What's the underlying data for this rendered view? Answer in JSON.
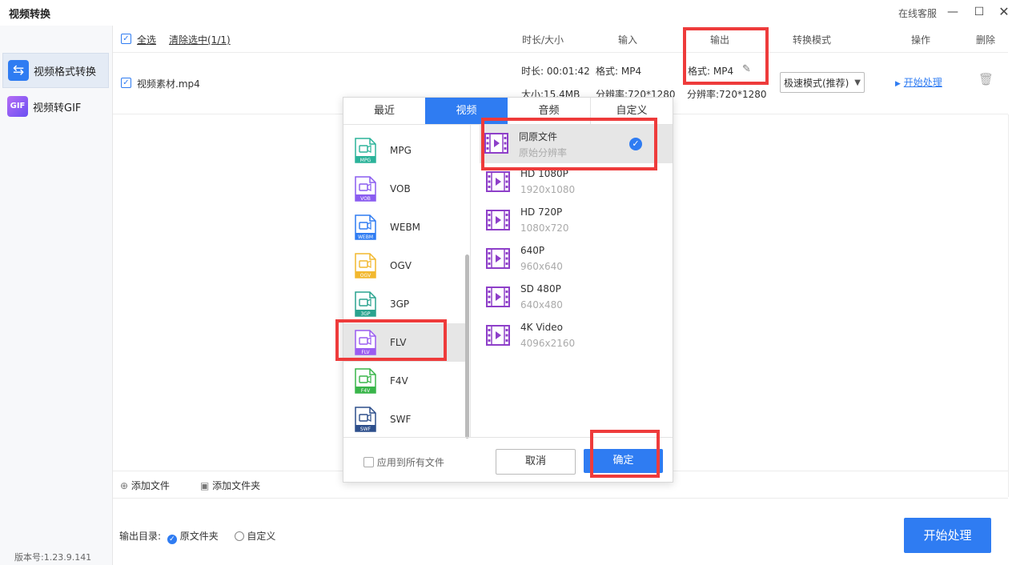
{
  "window": {
    "title": "视频转换",
    "support": "在线客服"
  },
  "sidebar": {
    "items": [
      {
        "label": "视频格式转换",
        "icon": "swap-arrows-icon",
        "active": true
      },
      {
        "label": "视频转GIF",
        "icon_text": "GIF"
      }
    ],
    "version": "版本号:1.23.9.141"
  },
  "table": {
    "select_all": "全选",
    "clear_selected": "清除选中(1/1)",
    "headers": {
      "duration_size": "时长/大小",
      "input": "输入",
      "output": "输出",
      "mode": "转换模式",
      "action": "操作",
      "delete": "删除"
    }
  },
  "file": {
    "name": "视频素材.mp4",
    "duration": "时长: 00:01:42",
    "size": "大小:15.4MB",
    "input_format": "格式: MP4",
    "input_resolution": "分辨率:720*1280",
    "output_format": "格式: MP4",
    "output_resolution": "分辨率:720*1280",
    "mode": "极速模式(推荐)",
    "start": "开始处理"
  },
  "toolbar": {
    "add_file": "添加文件",
    "add_folder": "添加文件夹"
  },
  "footer": {
    "output_dir_label": "输出目录:",
    "original_folder": "原文件夹",
    "custom": "自定义",
    "start_button": "开始处理"
  },
  "popup": {
    "tabs": [
      "最近",
      "视频",
      "音频",
      "自定义"
    ],
    "active_tab": "视频",
    "formats": [
      {
        "name": "MPG",
        "color": "#2bb39a"
      },
      {
        "name": "VOB",
        "color": "#8a5cf0"
      },
      {
        "name": "WEBM",
        "color": "#2f7cf2"
      },
      {
        "name": "OGV",
        "color": "#f2b82f"
      },
      {
        "name": "3GP",
        "color": "#2aa38f"
      },
      {
        "name": "FLV",
        "color": "#9a5cf0"
      },
      {
        "name": "F4V",
        "color": "#39b54a"
      },
      {
        "name": "SWF",
        "color": "#2d4f8c"
      }
    ],
    "selected_format": "FLV",
    "resolutions": [
      {
        "name": "同原文件",
        "sub": "原始分辨率"
      },
      {
        "name": "HD 1080P",
        "sub": "1920x1080"
      },
      {
        "name": "HD 720P",
        "sub": "1080x720"
      },
      {
        "name": "640P",
        "sub": "960x640"
      },
      {
        "name": "SD 480P",
        "sub": "640x480"
      },
      {
        "name": "4K Video",
        "sub": "4096x2160"
      }
    ],
    "selected_resolution": "同原文件",
    "apply_all": "应用到所有文件",
    "cancel": "取消",
    "confirm": "确定"
  },
  "colors": {
    "accent": "#2f7cf2",
    "highlight": "#ee3b3b"
  }
}
